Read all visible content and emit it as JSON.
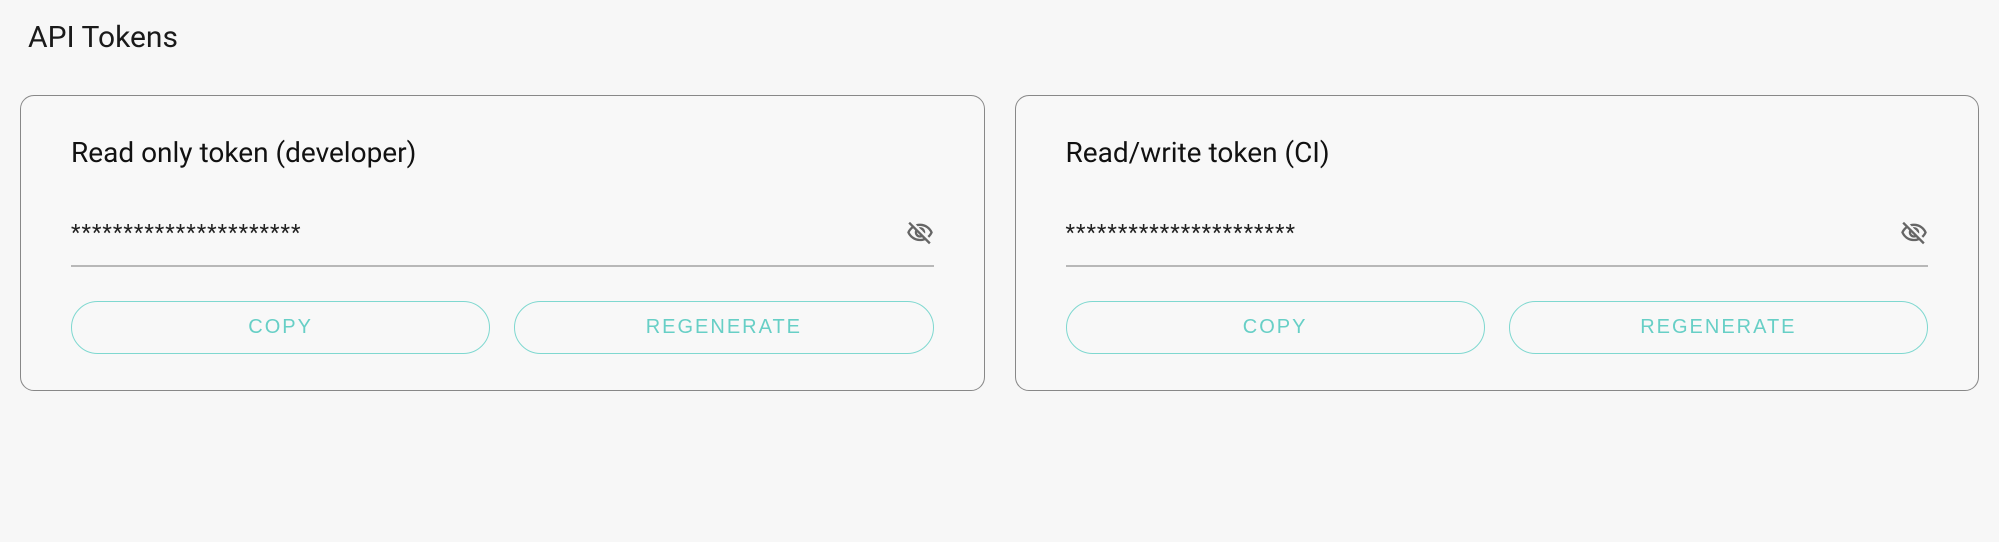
{
  "page": {
    "title": "API Tokens"
  },
  "tokens": [
    {
      "title": "Read only token (developer)",
      "masked_value": "**********************",
      "copy_label": "COPY",
      "regenerate_label": "REGENERATE"
    },
    {
      "title": "Read/write token (CI)",
      "masked_value": "**********************",
      "copy_label": "COPY",
      "regenerate_label": "REGENERATE"
    }
  ]
}
